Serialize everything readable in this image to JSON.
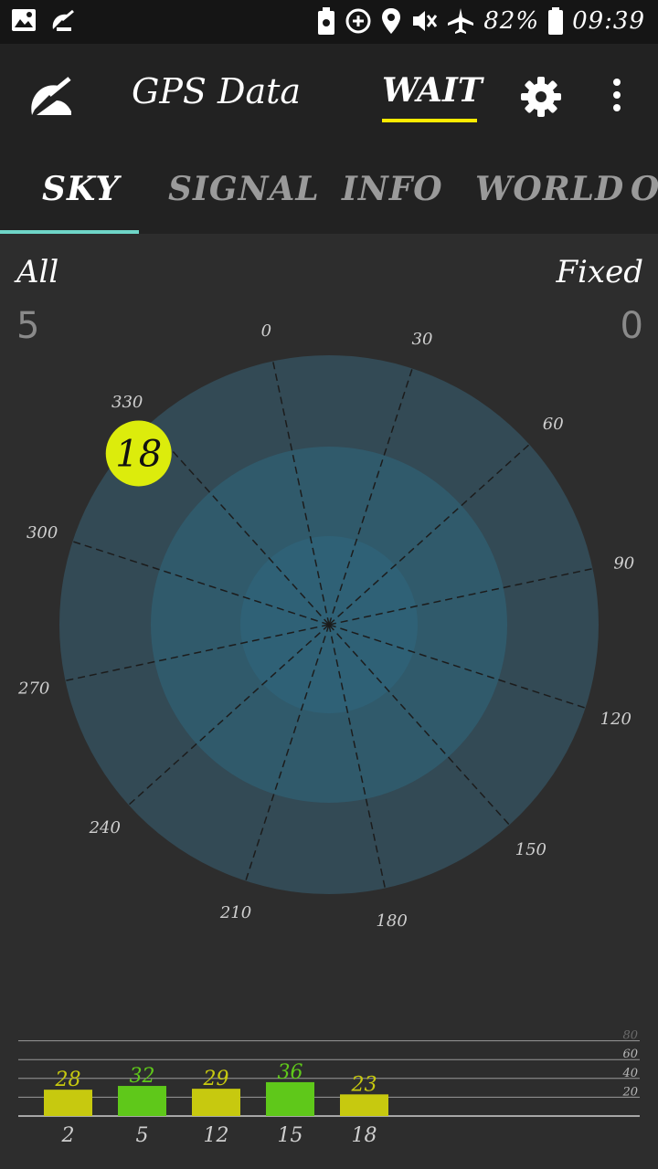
{
  "status_bar": {
    "icons": [
      "image-icon",
      "satellite-icon",
      "battery-saver-icon",
      "data-saver-icon",
      "location-icon",
      "vibrate-icon",
      "airplane-icon",
      "battery-icon"
    ],
    "battery": "82%",
    "time": "09:39"
  },
  "app_bar": {
    "title": "GPS Data",
    "wait_label": "WAIT",
    "logo_icon": "satellite-dish-icon",
    "settings_icon": "gear-icon",
    "more_icon": "more-vert-icon"
  },
  "tabs": [
    {
      "label": "SKY",
      "active": true
    },
    {
      "label": "SIGNAL",
      "active": false
    },
    {
      "label": "INFO",
      "active": false
    },
    {
      "label": "WORLD",
      "active": false
    },
    {
      "label": "OTHER",
      "active": false
    }
  ],
  "sky": {
    "all_label": "All",
    "all_count": "5",
    "fixed_label": "Fixed",
    "fixed_count": "0"
  },
  "colors": {
    "accent": "#ffeb00",
    "tab_indicator": "#6fd6c8",
    "ring_outer": "#334a55",
    "ring_middle": "#305a6b",
    "ring_inner": "#2f6176",
    "bar_yellow": "#c7c90f",
    "bar_green": "#5fc81a",
    "sat_marker": "#dcec0c"
  },
  "chart_data": [
    {
      "type": "polar-skyplot",
      "rotation_deg": -12,
      "azimuth_ticks": [
        "0",
        "30",
        "60",
        "90",
        "120",
        "150",
        "180",
        "210",
        "240",
        "270",
        "300",
        "330"
      ],
      "rings": 3,
      "satellites": [
        {
          "prn": "18",
          "azimuth": 324,
          "elevation": 0
        }
      ]
    },
    {
      "type": "bar",
      "categories": [
        "2",
        "5",
        "12",
        "15",
        "18"
      ],
      "values": [
        28,
        32,
        29,
        36,
        23
      ],
      "bar_colors": [
        "#c7c90f",
        "#5fc81a",
        "#c7c90f",
        "#5fc81a",
        "#c7c90f"
      ],
      "ylim": [
        0,
        80
      ],
      "yticks": [
        "20",
        "40",
        "60",
        "80"
      ]
    }
  ]
}
